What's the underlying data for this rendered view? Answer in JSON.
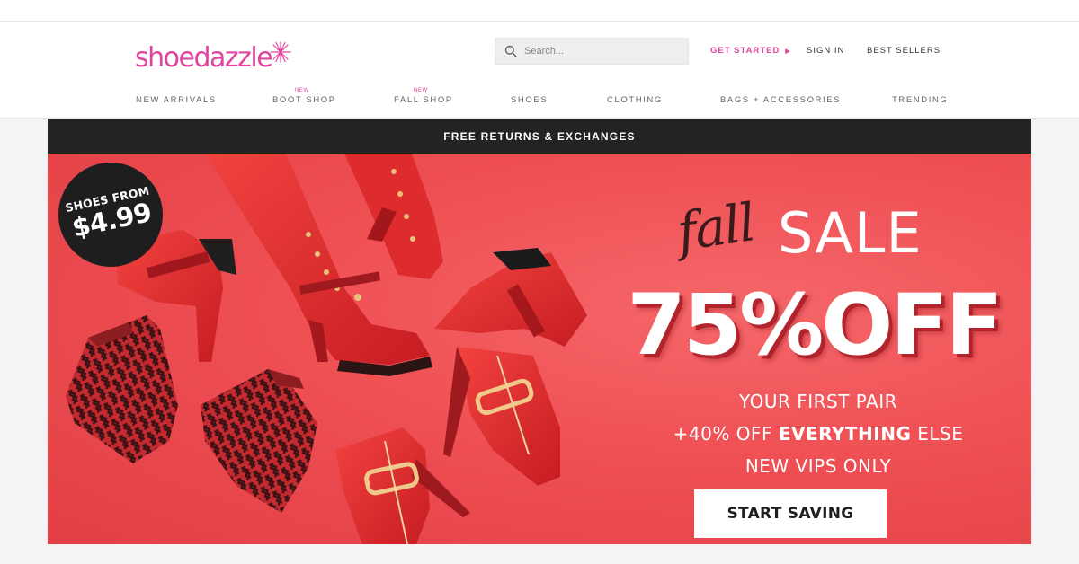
{
  "brand": {
    "logo_text": "shoedazzle",
    "accent_color": "#e0469d"
  },
  "search": {
    "placeholder": "Search..."
  },
  "header_links": {
    "get_started": "GET STARTED",
    "sign_in": "SIGN IN",
    "best_sellers": "BEST SELLERS"
  },
  "nav": {
    "items": [
      {
        "label": "NEW ARRIVALS",
        "badge": ""
      },
      {
        "label": "BOOT SHOP",
        "badge": "NEW"
      },
      {
        "label": "FALL SHOP",
        "badge": "NEW"
      },
      {
        "label": "SHOES",
        "badge": ""
      },
      {
        "label": "CLOTHING",
        "badge": ""
      },
      {
        "label": "BAGS + ACCESSORIES",
        "badge": ""
      },
      {
        "label": "TRENDING",
        "badge": ""
      }
    ]
  },
  "promo_bar": {
    "text": "FREE RETURNS & EXCHANGES"
  },
  "hero": {
    "badge_line1": "SHOES FROM",
    "badge_price": "$4.99",
    "fall_script": "fall",
    "sale_word": "SALE",
    "headline": "75%OFF",
    "line1": "YOUR FIRST PAIR",
    "line2_prefix": "+40% OFF ",
    "line2_bold": "EVERYTHING",
    "line2_suffix": " ELSE",
    "line3": "NEW VIPS ONLY",
    "cta_label": "START SAVING",
    "background_color": "#ef5054"
  }
}
